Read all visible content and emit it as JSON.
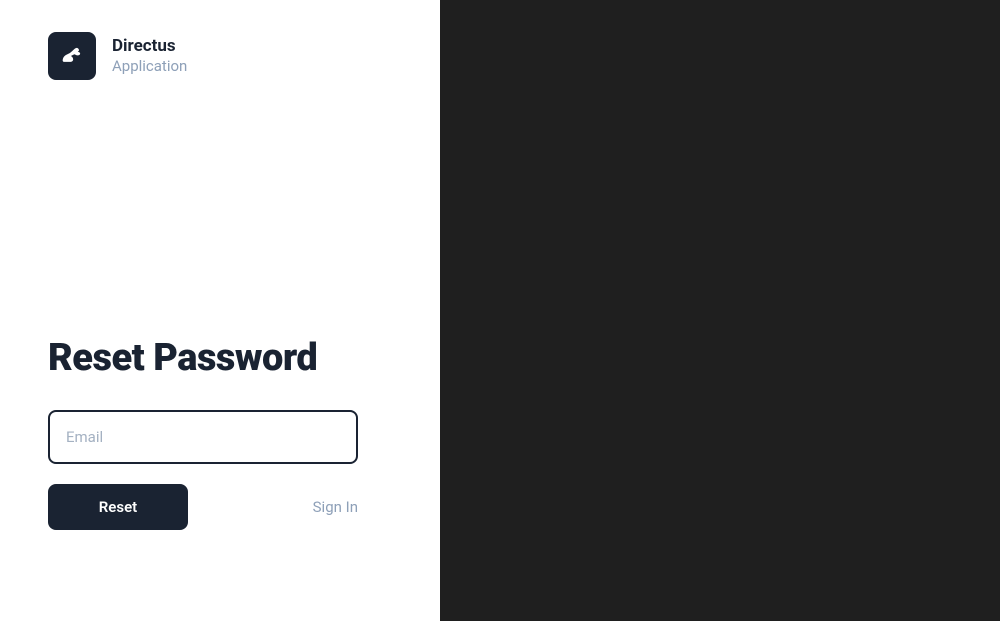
{
  "brand": {
    "name": "Directus",
    "subtitle": "Application"
  },
  "form": {
    "title": "Reset Password",
    "email_placeholder": "Email",
    "reset_label": "Reset",
    "signin_label": "Sign In"
  }
}
